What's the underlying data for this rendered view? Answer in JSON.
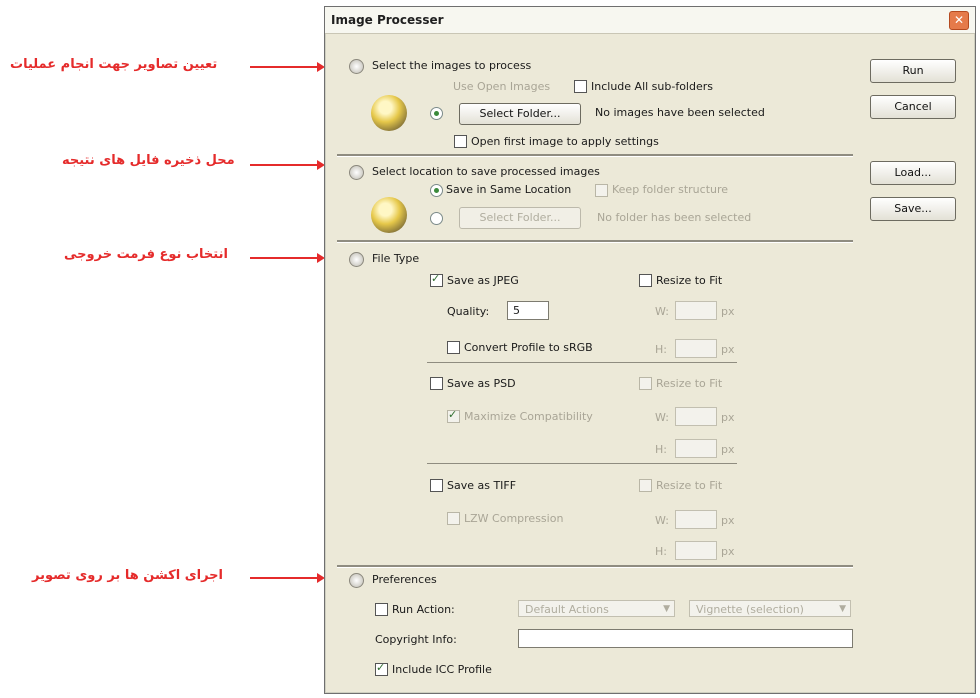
{
  "annotations": [
    "تعیین تصاویر جهت انجام عملیات",
    "محل ذخیره فایل های نتیجه",
    "انتخاب نوع فرمت خروجی",
    "اجرای اکشن ها بر روی تصویر"
  ],
  "dialog": {
    "title": "Image Processer",
    "close_glyph": "✕"
  },
  "section1": {
    "heading": "Select the images to process",
    "use_open_images": "Use Open Images",
    "include_subfolders": "Include All sub-folders",
    "select_folder_button": "Select Folder...",
    "status": "No images have been selected",
    "open_first_image": "Open first image to apply settings"
  },
  "section2": {
    "heading": "Select location to save processed images",
    "save_same_location": "Save in Same Location",
    "keep_folder_structure": "Keep folder structure",
    "select_folder_button": "Select Folder...",
    "status": "No folder has been selected"
  },
  "section3": {
    "heading": "File Type",
    "save_as_jpeg": "Save as JPEG",
    "resize_to_fit_1": "Resize to Fit",
    "quality_label": "Quality:",
    "quality_value": "5",
    "convert_profile": "Convert Profile to sRGB",
    "save_as_psd": "Save as PSD",
    "resize_to_fit_2": "Resize to Fit",
    "maximize_compatibility": "Maximize Compatibility",
    "save_as_tiff": "Save as TIFF",
    "resize_to_fit_3": "Resize to Fit",
    "lzw_compression": "LZW Compression",
    "w_label": "W:",
    "h_label": "H:",
    "px_label": "px"
  },
  "section4": {
    "heading": "Preferences",
    "run_action": "Run Action:",
    "action_set": "Default Actions",
    "action_name": "Vignette (selection)",
    "copyright_label": "Copyright Info:",
    "copyright_value": "",
    "include_icc": "Include ICC Profile"
  },
  "buttons": {
    "run": "Run",
    "cancel": "Cancel",
    "load": "Load...",
    "save": "Save..."
  }
}
